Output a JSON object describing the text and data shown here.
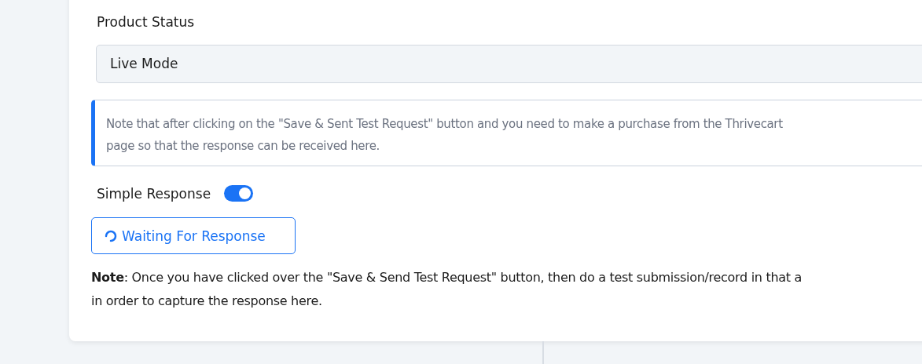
{
  "product_status": {
    "label": "Product Status",
    "value": "Live Mode"
  },
  "info_note": {
    "lines": [
      "Note that after clicking on the \"Save & Sent Test Request\" button and you need to make a purchase from the Thrivecart",
      "page so that the response can be received here."
    ]
  },
  "simple_response": {
    "label": "Simple Response",
    "on": true
  },
  "waiting_button": {
    "label": "Waiting For Response",
    "loading": true
  },
  "note": {
    "lines": [
      "**Note**: Once you have clicked over the \"Save & Send Test Request\" button, then do a test submission/record in that a",
      "in order to capture the response here."
    ]
  }
}
